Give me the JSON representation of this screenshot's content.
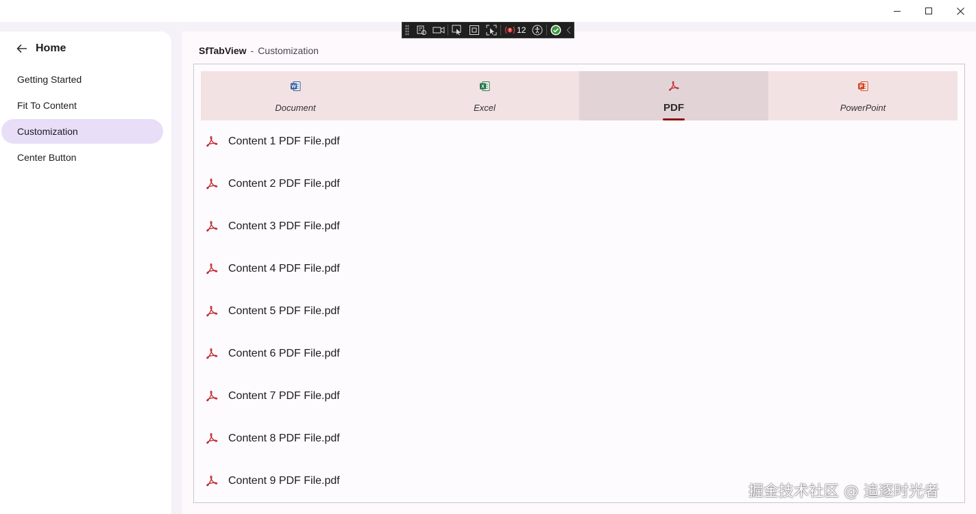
{
  "window": {
    "minimize": "minimize",
    "maximize": "maximize",
    "close": "close"
  },
  "debug_toolbar": {
    "error_count": "12"
  },
  "sidebar": {
    "home_label": "Home",
    "items": [
      {
        "label": "Getting Started",
        "active": false
      },
      {
        "label": "Fit To Content",
        "active": false
      },
      {
        "label": "Customization",
        "active": true
      },
      {
        "label": "Center Button",
        "active": false
      }
    ]
  },
  "breadcrumb": {
    "control": "SfTabView",
    "separator": "-",
    "page": "Customization"
  },
  "tabs": [
    {
      "label": "Document",
      "icon": "word-icon",
      "color": "#2b579a"
    },
    {
      "label": "Excel",
      "icon": "excel-icon",
      "color": "#217346"
    },
    {
      "label": "PDF",
      "icon": "pdf-icon",
      "color": "#c0262d",
      "active": true
    },
    {
      "label": "PowerPoint",
      "icon": "powerpoint-icon",
      "color": "#d24726"
    }
  ],
  "files": [
    "Content 1 PDF File.pdf",
    "Content 2 PDF File.pdf",
    "Content 3 PDF File.pdf",
    "Content 4 PDF File.pdf",
    "Content 5 PDF File.pdf",
    "Content 6 PDF File.pdf",
    "Content 7 PDF File.pdf",
    "Content 8 PDF File.pdf",
    "Content 9 PDF File.pdf"
  ],
  "watermark": "掘金技术社区 @ 追逐时光者",
  "colors": {
    "accent_indicator": "#8b1010",
    "nav_active": "#e8def8",
    "tab_bar": "#f3e2e4",
    "tab_active": "#e2d3d6"
  }
}
